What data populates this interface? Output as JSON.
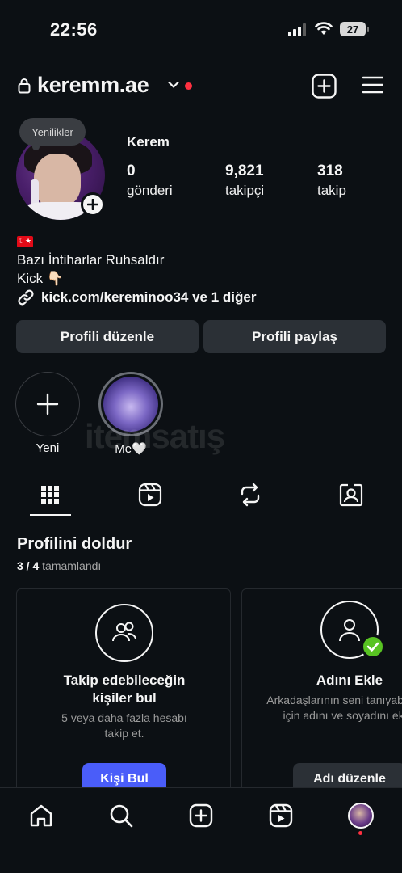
{
  "status_bar": {
    "time": "22:56",
    "battery": "27"
  },
  "header": {
    "username": "keremm.ae"
  },
  "profile": {
    "note": "Yenilikler",
    "display_name": "Kerem",
    "stats": [
      {
        "value": "0",
        "label": "gönderi"
      },
      {
        "value": "9,821",
        "label": "takipçi"
      },
      {
        "value": "318",
        "label": "takip"
      }
    ],
    "bio_flag": "☾★",
    "bio_line1": "Bazı İntiharlar Ruhsaldır",
    "bio_line2": "Kick 👇🏻",
    "link": "kick.com/kereminoo34 ve 1 diğer"
  },
  "buttons": {
    "edit": "Profili düzenle",
    "share": "Profili paylaş"
  },
  "highlights": [
    {
      "label": "Yeni"
    },
    {
      "label": "Me🤍"
    }
  ],
  "watermark": "itemsatış",
  "complete_profile": {
    "title": "Profilini doldur",
    "progress": "3 / 4",
    "progress_label": "tamamlandı",
    "cards": [
      {
        "title_line1": "Takip edebileceğin",
        "title_line2": "kişiler bul",
        "desc_line1": "5 veya daha fazla hesabı",
        "desc_line2": "takip et.",
        "button": "Kişi Bul",
        "icon": "people-icon"
      },
      {
        "title_line1": "Adını Ekle",
        "desc_line1": "Arkadaşlarının seni tanıyabilmesi",
        "desc_line2": "için adını ve soyadını ekle.",
        "button": "Adı düzenle",
        "icon": "user-icon"
      }
    ]
  },
  "icons": [
    "lock-icon",
    "chevron-down-icon",
    "plus-square-icon",
    "menu-icon",
    "grid-icon",
    "reels-icon",
    "repost-icon",
    "tagged-icon",
    "home-icon",
    "search-icon",
    "create-icon",
    "reels-nav-icon",
    "profile-avatar"
  ],
  "colors": {
    "background": "#0c1014",
    "button": "#2b3036",
    "accent_blue": "#4a5df9",
    "red_dot": "#ff3040",
    "check_green": "#58c322"
  }
}
